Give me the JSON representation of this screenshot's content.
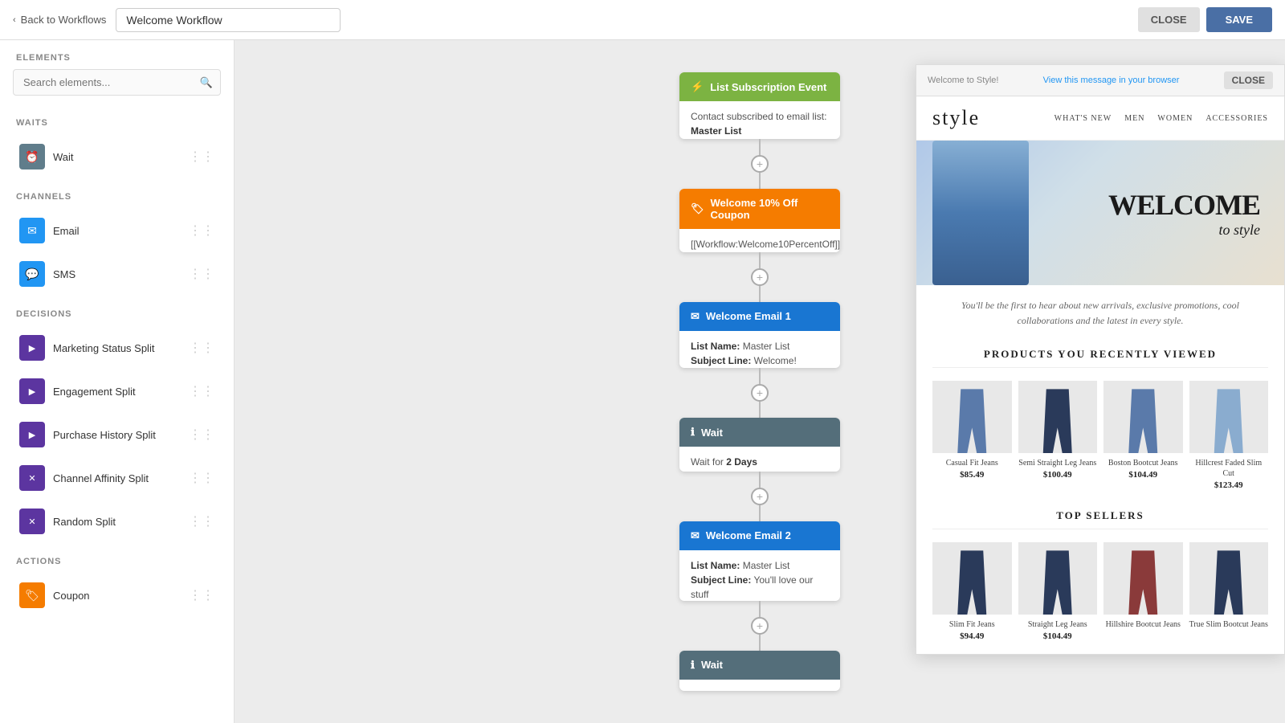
{
  "header": {
    "back_label": "Back to Workflows",
    "workflow_title": "Welcome Workflow",
    "close_label": "CLOSE",
    "save_label": "SAVE"
  },
  "sidebar": {
    "sections": [
      {
        "id": "elements",
        "title": "ELEMENTS",
        "search_placeholder": "Search elements..."
      },
      {
        "id": "waits",
        "title": "WAITS",
        "items": [
          {
            "id": "wait",
            "label": "Wait",
            "icon": "clock",
            "color": "gray"
          }
        ]
      },
      {
        "id": "channels",
        "title": "CHANNELS",
        "items": [
          {
            "id": "email",
            "label": "Email",
            "icon": "envelope",
            "color": "blue"
          },
          {
            "id": "sms",
            "label": "SMS",
            "icon": "chat",
            "color": "blue"
          }
        ]
      },
      {
        "id": "decisions",
        "title": "DECISIONS",
        "items": [
          {
            "id": "marketing-status-split",
            "label": "Marketing Status Split",
            "icon": "split",
            "color": "purple"
          },
          {
            "id": "engagement-split",
            "label": "Engagement Split",
            "icon": "split",
            "color": "purple"
          },
          {
            "id": "purchase-history-split",
            "label": "Purchase History Split",
            "icon": "split",
            "color": "purple"
          },
          {
            "id": "channel-affinity-split",
            "label": "Channel Affinity Split",
            "icon": "split-x",
            "color": "purple"
          },
          {
            "id": "random-split",
            "label": "Random Split",
            "icon": "split-x",
            "color": "purple"
          }
        ]
      },
      {
        "id": "actions",
        "title": "ACTIONS",
        "items": [
          {
            "id": "coupon",
            "label": "Coupon",
            "icon": "tag",
            "color": "orange"
          }
        ]
      }
    ]
  },
  "workflow": {
    "nodes": [
      {
        "id": "list-subscription-event",
        "type": "event",
        "header_color": "green",
        "header_icon": "⚡",
        "title": "List Subscription Event",
        "body_lines": [
          {
            "text": "Contact subscribed to email list: "
          },
          {
            "bold": "Master List"
          }
        ]
      },
      {
        "id": "welcome-coupon",
        "type": "action",
        "header_color": "orange",
        "header_icon": "🏷",
        "title": "Welcome 10% Off Coupon",
        "body_lines": [
          {
            "text": "[[Workflow:Welcome10PercentOff]]"
          }
        ]
      },
      {
        "id": "welcome-email-1",
        "type": "email",
        "header_color": "blue",
        "header_icon": "✉",
        "title": "Welcome Email 1",
        "body_lines": [
          {
            "label": "List Name:",
            "value": "Master List"
          },
          {
            "label": "Subject Line:",
            "value": "Welcome!"
          }
        ]
      },
      {
        "id": "wait-1",
        "type": "wait",
        "header_color": "dark-gray",
        "header_icon": "ℹ",
        "title": "Wait",
        "body_lines": [
          {
            "text": "Wait for "
          },
          {
            "bold": "2 Days"
          }
        ]
      },
      {
        "id": "welcome-email-2",
        "type": "email",
        "header_color": "blue",
        "header_icon": "✉",
        "title": "Welcome Email 2",
        "body_lines": [
          {
            "label": "List Name:",
            "value": "Master List"
          },
          {
            "label": "Subject Line:",
            "value": "You'll love our stuff"
          }
        ]
      },
      {
        "id": "wait-2",
        "type": "wait",
        "header_color": "dark-gray",
        "header_icon": "ℹ",
        "title": "Wait",
        "body_lines": []
      }
    ]
  },
  "email_preview": {
    "top_bar": {
      "title": "Welcome to Style!",
      "link": "View this message in your browser",
      "close_label": "CLOSE"
    },
    "nav": {
      "brand": "style",
      "links": [
        "WHAT'S NEW",
        "MEN",
        "WOMEN",
        "ACCESSORIES"
      ]
    },
    "hero": {
      "welcome_text": "WELCOME",
      "sub_text": "to style"
    },
    "intro_text": "You'll be the first to hear about new arrivals, exclusive promotions, cool collaborations and the latest in every style.",
    "recently_viewed": {
      "title": "PRODUCTS YOU RECENTLY VIEWED",
      "products": [
        {
          "name": "Casual Fit Jeans",
          "price": "$85.49",
          "color": "medium"
        },
        {
          "name": "Semi Straight Leg Jeans",
          "price": "$100.49",
          "color": "dark"
        },
        {
          "name": "Boston Bootcut Jeans",
          "price": "$104.49",
          "color": "medium"
        },
        {
          "name": "Hillcrest Faded Slim Cut",
          "price": "$123.49",
          "color": "light"
        }
      ]
    },
    "top_sellers": {
      "title": "TOP SELLERS",
      "products": [
        {
          "name": "Slim Fit Jeans",
          "price": "$94.49",
          "color": "dark"
        },
        {
          "name": "Straight Leg Jeans",
          "price": "$104.49",
          "color": "dark"
        },
        {
          "name": "Hillshire Bootcut Jeans",
          "price": "",
          "color": "red-plaid"
        },
        {
          "name": "True Slim Bootcut Jeans",
          "price": "",
          "color": "dark"
        }
      ]
    }
  }
}
